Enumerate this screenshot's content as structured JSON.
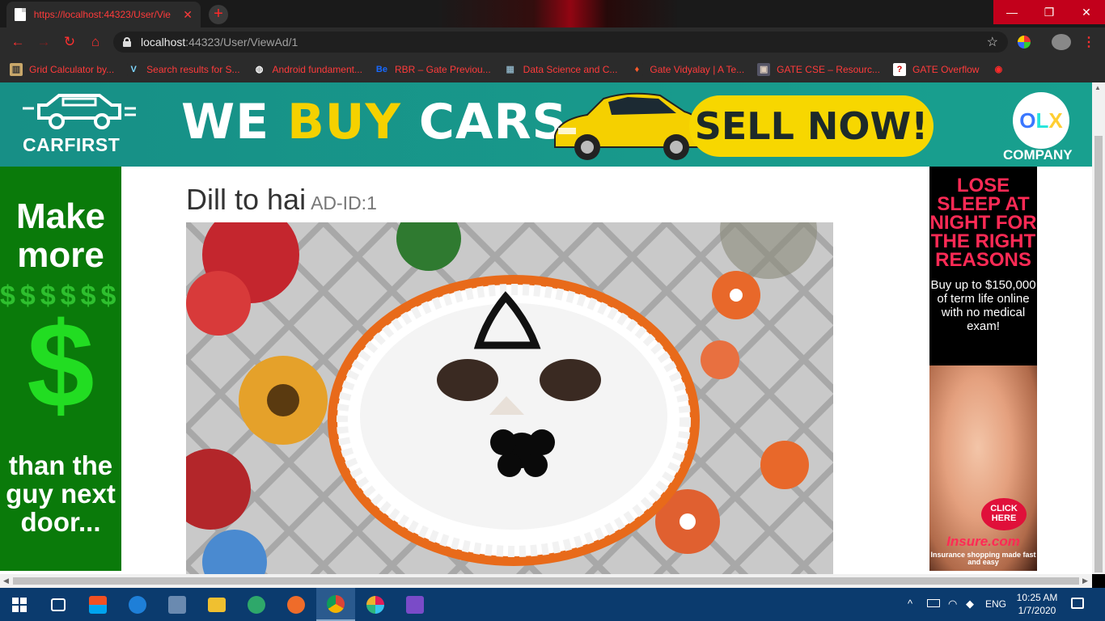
{
  "browser": {
    "tab_title": "https://localhost:44323/User/Vie",
    "tab_close": "✕",
    "new_tab": "+",
    "window_controls": {
      "minimize": "—",
      "maximize": "❐",
      "close": "✕"
    },
    "nav": {
      "back": "←",
      "forward": "→",
      "reload": "↻",
      "home": "⌂",
      "menu": "⋮"
    },
    "url_host": "localhost",
    "url_path": ":44323/User/ViewAd/1",
    "bookmarks": [
      {
        "label": "Grid Calculator by...",
        "icon": "grid-calculator-icon",
        "glyph": "▥",
        "bg": "#c9a86a",
        "fg": "#333"
      },
      {
        "label": "Search results for S...",
        "icon": "vuetify-icon",
        "glyph": "V",
        "bg": "#2b2b2b",
        "fg": "#7fd8ff"
      },
      {
        "label": "Android fundament...",
        "icon": "globe-icon",
        "glyph": "◍",
        "bg": "#2b2b2b",
        "fg": "#fff"
      },
      {
        "label": "RBR – Gate Previou...",
        "icon": "behance-icon",
        "glyph": "Be",
        "bg": "#2b2b2b",
        "fg": "#1769ff"
      },
      {
        "label": "Data Science and C...",
        "icon": "data-science-icon",
        "glyph": "▦",
        "bg": "#2b2b2b",
        "fg": "#8ab"
      },
      {
        "label": "Gate Vidyalay | A Te...",
        "icon": "bulb-icon",
        "glyph": "♦",
        "bg": "#2b2b2b",
        "fg": "#ff5a2a"
      },
      {
        "label": "GATE CSE – Resourc...",
        "icon": "gate-cse-icon",
        "glyph": "▣",
        "bg": "#556",
        "fg": "#dcb"
      },
      {
        "label": "GATE Overflow",
        "icon": "gate-overflow-icon",
        "glyph": "?",
        "bg": "#fff",
        "fg": "#c00"
      },
      {
        "label": "",
        "icon": "circle-red-icon",
        "glyph": "◉",
        "bg": "#2b2b2b",
        "fg": "#ff2a2a"
      }
    ]
  },
  "page": {
    "top_banner": {
      "brand": "CARFIRST",
      "headline_white": "WE ",
      "headline_yellow": "BUY",
      "headline_rest": " CARS",
      "cta": "SELL NOW!",
      "partner_o": "O",
      "partner_l": "L",
      "partner_x": "X",
      "partner_sub": "COMPANY",
      "colors": {
        "bg": "#178f86",
        "accent": "#f7d700"
      }
    },
    "left_ad": {
      "top_text": "Make more",
      "bottom_text": "than the guy next door...",
      "colors": {
        "bg": "#0a7a0a",
        "dollar": "#22dd22"
      }
    },
    "right_ad": {
      "headline": "LOSE SLEEP AT NIGHT FOR THE RIGHT REASONS",
      "sub": "Buy up to $150,000 of term life online with no medical exam!",
      "cta": "CLICK HERE",
      "brand": "Insure.com",
      "tagline": "Insurance shopping made fast and easy",
      "colors": {
        "bg": "#000000",
        "accent": "#ff2a55"
      }
    },
    "ad": {
      "title": "Dill to hai",
      "id_label": "AD-ID:1"
    }
  },
  "taskbar": {
    "icons": [
      {
        "name": "start-icon"
      },
      {
        "name": "task-view-icon"
      },
      {
        "name": "store-icon"
      },
      {
        "name": "edge-icon"
      },
      {
        "name": "virtualbox-icon"
      },
      {
        "name": "file-explorer-icon"
      },
      {
        "name": "atom-icon"
      },
      {
        "name": "postman-icon"
      },
      {
        "name": "chrome-icon"
      },
      {
        "name": "slack-icon"
      },
      {
        "name": "visual-studio-icon"
      }
    ],
    "tray": {
      "chevron": "^",
      "language": "ENG",
      "time": "10:25 AM",
      "date": "1/7/2020"
    }
  }
}
